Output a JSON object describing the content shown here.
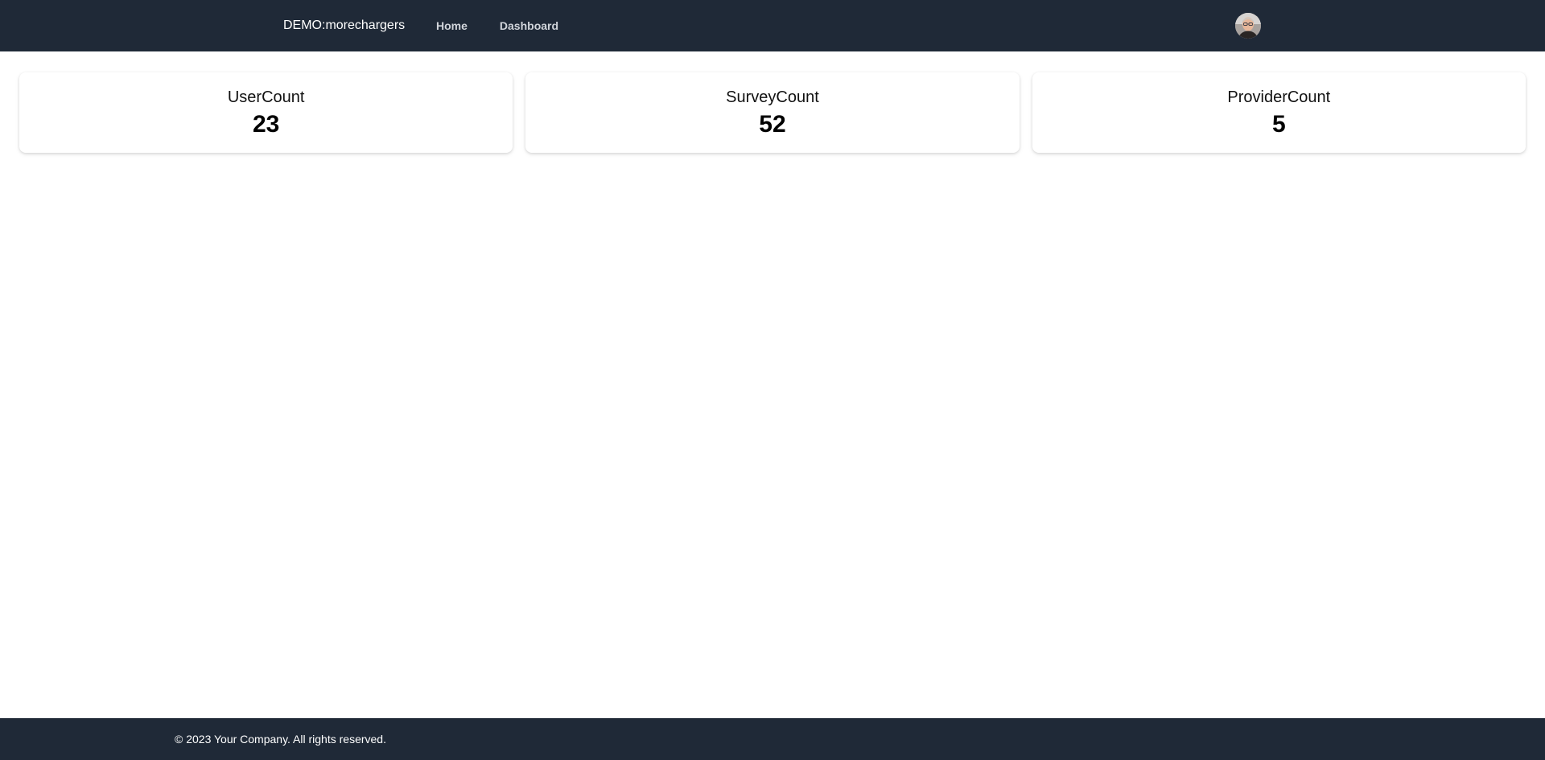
{
  "navbar": {
    "brand": "DEMO:morechargers",
    "links": [
      {
        "label": "Home"
      },
      {
        "label": "Dashboard"
      }
    ],
    "avatar_icon": "user-avatar-photo"
  },
  "stats": [
    {
      "label": "UserCount",
      "value": "23"
    },
    {
      "label": "SurveyCount",
      "value": "52"
    },
    {
      "label": "ProviderCount",
      "value": "5"
    }
  ],
  "footer": {
    "copyright": "© 2023 Your Company. All rights reserved."
  },
  "colors": {
    "navbar_bg": "#1f2937",
    "footer_bg": "#1f2937",
    "nav_link": "#d1d5db",
    "page_bg": "#ffffff"
  }
}
